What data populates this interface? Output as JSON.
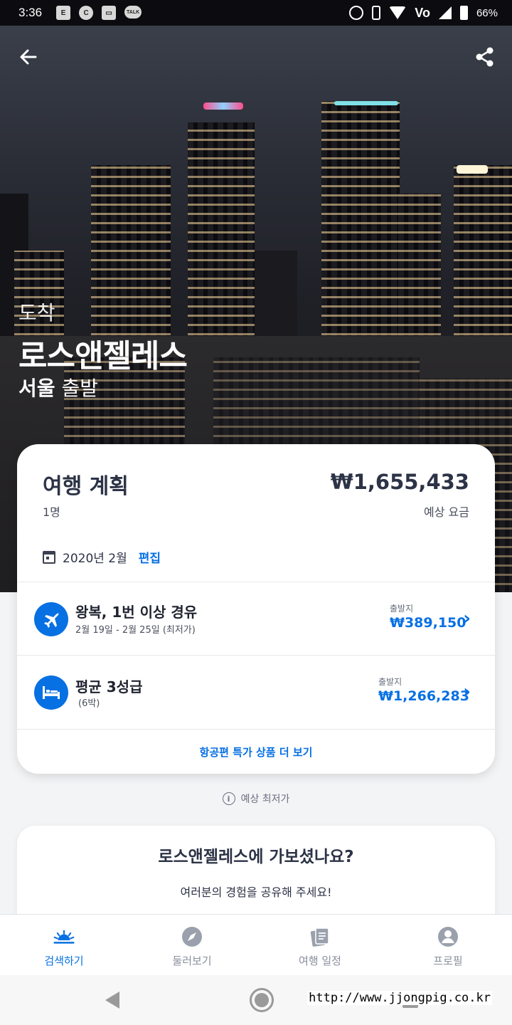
{
  "status_bar": {
    "time": "3:36",
    "notifications": [
      "E",
      "C",
      "▭",
      "TALK"
    ],
    "volte": "Vo",
    "battery": "66%"
  },
  "hero": {
    "label": "도착",
    "city": "로스앤젤레스",
    "origin_city": "서울",
    "origin_suffix": "출발"
  },
  "plan": {
    "title": "여행 계획",
    "total_price": "₩1,655,433",
    "travelers": "1명",
    "price_label": "예상 요금",
    "date": "2020년 2월",
    "edit_label": "편집"
  },
  "flight": {
    "title": "왕복, 1번 이상 경유",
    "subtitle": "2월 19일 - 2월 25일 (최저가)",
    "price_label": "출발지",
    "price": "₩389,150"
  },
  "hotel": {
    "title": "평균 3성급",
    "subtitle": "(6박)",
    "price_label": "출발지",
    "price": "₩1,266,283"
  },
  "more_link": "항공편 특가 상품 더 보기",
  "estimate_note": "예상 최저가",
  "review": {
    "title": "로스앤젤레스에 가보셨나요?",
    "subtitle": "여러분의 경험을 공유해 주세요!"
  },
  "bottom_nav": {
    "items": [
      {
        "label": "검색하기",
        "icon": "sunrise-icon",
        "active": true
      },
      {
        "label": "둘러보기",
        "icon": "compass-icon",
        "active": false
      },
      {
        "label": "여행 일정",
        "icon": "trips-icon",
        "active": false
      },
      {
        "label": "프로필",
        "icon": "profile-icon",
        "active": false
      }
    ]
  },
  "watermark": "http://www.jjongpig.co.kr",
  "colors": {
    "accent": "#0770e3",
    "text_dark": "#2c3346"
  }
}
